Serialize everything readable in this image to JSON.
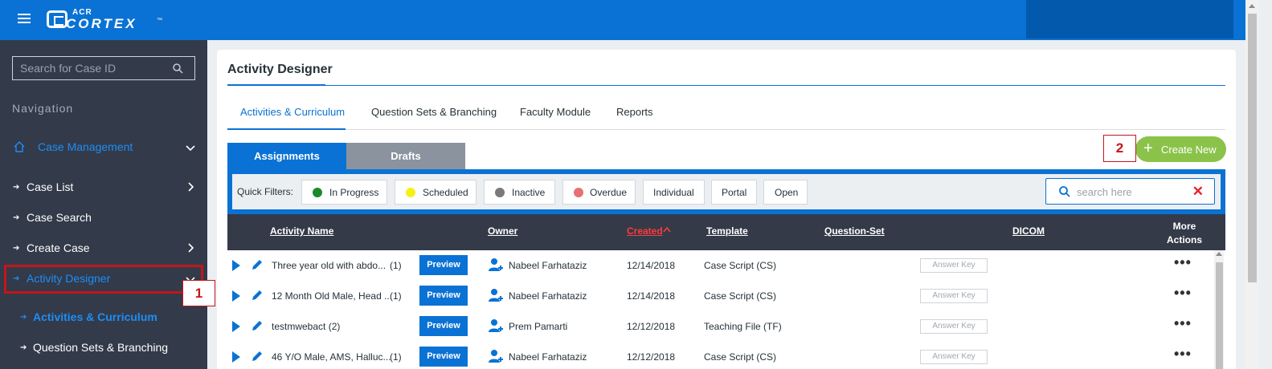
{
  "header": {
    "logo_top": "ACR",
    "logo_main": "CORTEX",
    "logo_tm": "™"
  },
  "sidebar": {
    "search_placeholder": "Search for Case ID",
    "nav_heading": "Navigation",
    "case_management": "Case Management",
    "items": [
      {
        "label": "Case List"
      },
      {
        "label": "Case Search"
      },
      {
        "label": "Create Case"
      },
      {
        "label": "Activity Designer"
      },
      {
        "label": "Activities & Curriculum"
      },
      {
        "label": "Question Sets & Branching"
      }
    ]
  },
  "callouts": {
    "one": "1",
    "two": "2"
  },
  "main": {
    "title": "Activity Designer",
    "tabs": [
      {
        "label": "Activities & Curriculum"
      },
      {
        "label": "Question Sets & Branching"
      },
      {
        "label": "Faculty Module"
      },
      {
        "label": "Reports"
      }
    ],
    "subtabs": [
      {
        "label": "Assignments"
      },
      {
        "label": "Drafts"
      }
    ],
    "create_new": "Create New",
    "quick_filters_label": "Quick Filters:",
    "filters": [
      {
        "label": "In Progress",
        "color": "#1a8a2a"
      },
      {
        "label": "Scheduled",
        "color": "#f5f018"
      },
      {
        "label": "Inactive",
        "color": "#7a7a7a"
      },
      {
        "label": "Overdue",
        "color": "#e87070"
      },
      {
        "label": "Individual"
      },
      {
        "label": "Portal"
      },
      {
        "label": "Open"
      }
    ],
    "search_placeholder": "search here",
    "columns": {
      "activity_name": "Activity Name",
      "owner": "Owner",
      "created": "Created",
      "template": "Template",
      "question_set": "Question-Set",
      "dicom": "DICOM",
      "more_actions_1": "More",
      "more_actions_2": "Actions"
    },
    "rows": [
      {
        "name": "Three year old with abdo...",
        "count": "(1)",
        "preview": "Preview",
        "owner": "Nabeel Farhataziz",
        "created": "12/14/2018",
        "template": "Case Script (CS)",
        "answer_key": "Answer Key",
        "more": "•••"
      },
      {
        "name": "12 Month Old Male, Head ...",
        "count": "(1)",
        "preview": "Preview",
        "owner": "Nabeel Farhataziz",
        "created": "12/14/2018",
        "template": "Case Script (CS)",
        "answer_key": "Answer Key",
        "more": "•••"
      },
      {
        "name": "testmwebact (2)",
        "count": "",
        "preview": "Preview",
        "owner": "Prem Pamarti",
        "created": "12/12/2018",
        "template": "Teaching File (TF)",
        "answer_key": "Answer Key",
        "more": "•••"
      },
      {
        "name": "46 Y/O Male, AMS, Halluc...",
        "count": "(1)",
        "preview": "Preview",
        "owner": "Nabeel Farhataziz",
        "created": "12/12/2018",
        "template": "Case Script (CS)",
        "answer_key": "Answer Key",
        "more": "•••"
      }
    ]
  }
}
